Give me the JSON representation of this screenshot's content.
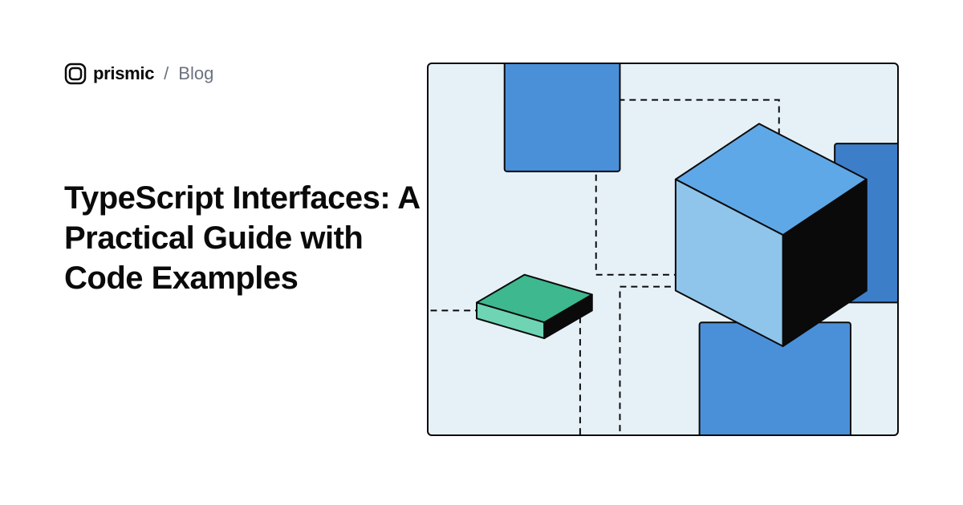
{
  "header": {
    "brand": "prismic",
    "separator": "/",
    "section": "Blog"
  },
  "title": "TypeScript Interfaces: A Practical Guide with Code Examples",
  "colors": {
    "background": "#ffffff",
    "illustration_bg": "#e6f1f7",
    "blue_square": "#4a90d9",
    "blue_square_alt": "#3d7ec9",
    "cube_top": "#5fa8e8",
    "cube_left": "#7bb8e8",
    "cube_right": "#0a0a0a",
    "green_top": "#3eb88f",
    "green_side": "#6fd4b3",
    "text": "#0a0a0a",
    "muted": "#6b7280"
  }
}
